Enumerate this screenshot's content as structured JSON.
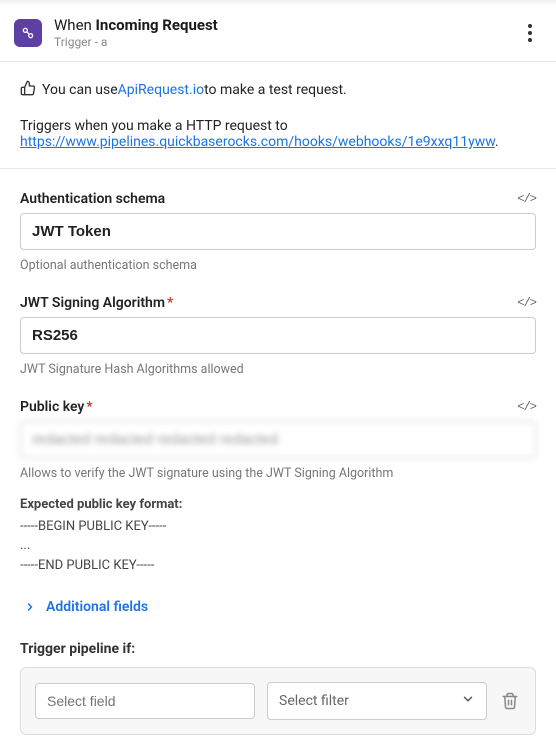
{
  "header": {
    "prefix": "When",
    "name": "Incoming Request",
    "subtitle": "Trigger - a"
  },
  "intro": {
    "pre_link": "You can use ",
    "link_text": "ApiRequest.io",
    "post_link": " to make a test request.",
    "trigger_text": "Triggers when you make a HTTP request to",
    "url": "https://www.pipelines.quickbaserocks.com/hooks/webhooks/1e9xxq11yww",
    "period": "."
  },
  "fields": {
    "auth": {
      "label": "Authentication schema",
      "value": "JWT Token",
      "help": "Optional authentication schema"
    },
    "algo": {
      "label": "JWT Signing Algorithm",
      "value": "RS256",
      "help": "JWT Signature Hash Algorithms allowed"
    },
    "pubkey": {
      "label": "Public key",
      "value": "redacted redacted redacted redacted",
      "help": "Allows to verify the JWT signature using the JWT Signing Algorithm"
    }
  },
  "format": {
    "title": "Expected public key format:",
    "line1": "-----BEGIN PUBLIC KEY-----",
    "line2": "...",
    "line3": "-----END PUBLIC KEY-----"
  },
  "additional_label": "Additional fields",
  "trigger_if": {
    "label": "Trigger pipeline if:",
    "field_placeholder": "Select field",
    "filter_placeholder": "Select filter"
  }
}
